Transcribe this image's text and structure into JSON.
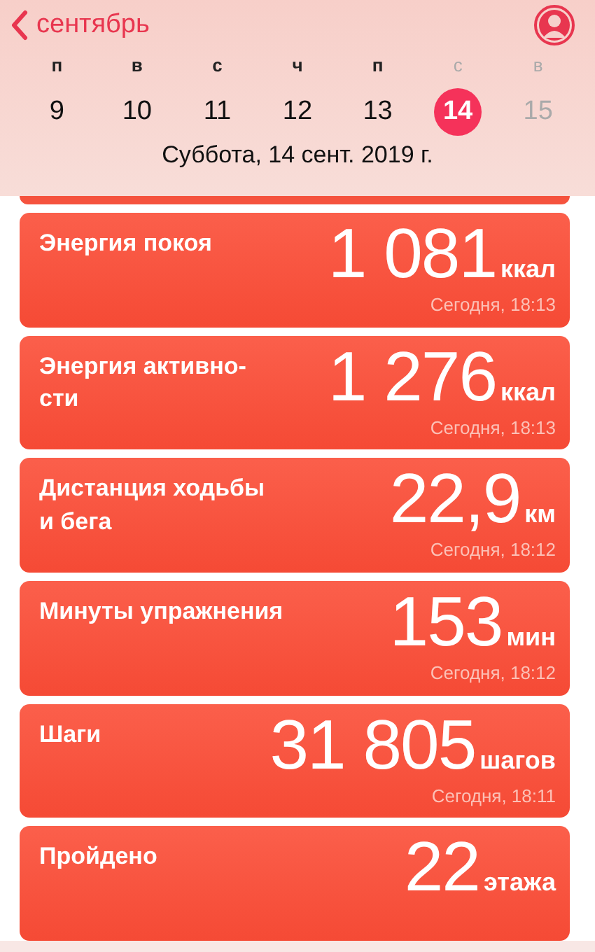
{
  "header": {
    "back_label": "сентябрь",
    "date_title": "Суббота, 14 сент. 2019 г."
  },
  "days": [
    {
      "weekday": "п",
      "date": "9",
      "weekend": false,
      "selected": false
    },
    {
      "weekday": "в",
      "date": "10",
      "weekend": false,
      "selected": false
    },
    {
      "weekday": "с",
      "date": "11",
      "weekend": false,
      "selected": false
    },
    {
      "weekday": "ч",
      "date": "12",
      "weekend": false,
      "selected": false
    },
    {
      "weekday": "п",
      "date": "13",
      "weekend": false,
      "selected": false
    },
    {
      "weekday": "с",
      "date": "14",
      "weekend": true,
      "selected": true
    },
    {
      "weekday": "в",
      "date": "15",
      "weekend": true,
      "selected": false
    }
  ],
  "cards": [
    {
      "title": "Энергия покоя",
      "value": "1 081",
      "unit": "ккал",
      "time": "Сегодня, 18:13"
    },
    {
      "title": "Энергия активно-\nсти",
      "value": "1 276",
      "unit": "ккал",
      "time": "Сегодня, 18:13"
    },
    {
      "title": "Дистанция ходьбы\nи бега",
      "value": "22,9",
      "unit": "км",
      "time": "Сегодня, 18:12"
    },
    {
      "title": "Минуты упражнения",
      "value": "153",
      "unit": "мин",
      "time": "Сегодня, 18:12"
    },
    {
      "title": "Шаги",
      "value": "31 805",
      "unit": "шагов",
      "time": "Сегодня, 18:11"
    },
    {
      "title": "Пройдено",
      "value": "22",
      "unit": "этажа"
    }
  ]
}
